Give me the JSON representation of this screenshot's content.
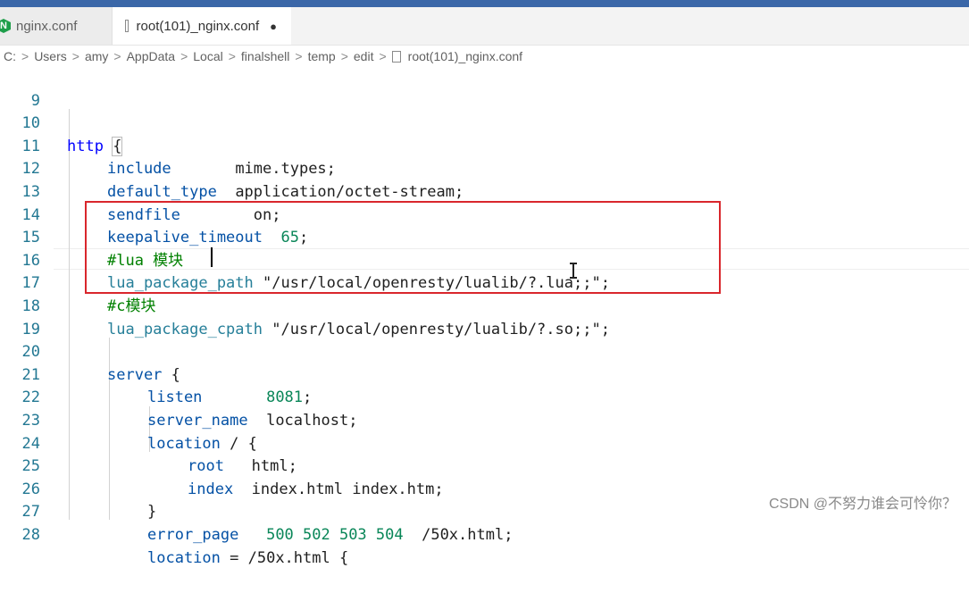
{
  "tabs": [
    {
      "label": "nginx.conf",
      "icon": "nginx-icon",
      "active": false
    },
    {
      "label": "root(101)_nginx.conf",
      "icon": "file-icon",
      "active": true,
      "dirty_marker": "●"
    }
  ],
  "breadcrumb": {
    "items": [
      "C:",
      "Users",
      "amy",
      "AppData",
      "Local",
      "finalshell",
      "temp",
      "edit"
    ],
    "file": "root(101)_nginx.conf",
    "separator": ">"
  },
  "lines": {
    "n9": "9",
    "n10": "10",
    "n11": "11",
    "n12": "12",
    "n13": "13",
    "n14": "14",
    "n15": "15",
    "n16": "16",
    "n17": "17",
    "n18": "18",
    "n19": "19",
    "n20": "20",
    "n21": "21",
    "n22": "22",
    "n23": "23",
    "n24": "24",
    "n25": "25",
    "n26": "26",
    "n27": "27",
    "n28": "28"
  },
  "code": {
    "l10_kw": "http",
    "l10_brace": "{",
    "l11_dir": "include",
    "l11_val": "mime.types;",
    "l12_dir": "default_type",
    "l12_val": "application/octet-stream;",
    "l13_dir": "sendfile",
    "l13_val": "on;",
    "l14_dir": "keepalive_timeout",
    "l14_num": "65",
    "l14_end": ";",
    "l15_comment": "#lua 模块",
    "l16_dir": "lua_package_path",
    "l16_val": "\"/usr/local/openresty/lualib/?.lua;;\";",
    "l17_comment": "#c模块",
    "l18_dir": "lua_package_cpath",
    "l18_val": "\"/usr/local/openresty/lualib/?.so;;\";",
    "l20_kw": "server",
    "l20_brace": "{",
    "l21_dir": "listen",
    "l21_num": "8081",
    "l21_end": ";",
    "l22_dir": "server_name",
    "l22_val": "localhost;",
    "l23_dir": "location",
    "l23_val": "/ {",
    "l24_dir": "root",
    "l24_val": "html;",
    "l25_dir": "index",
    "l25_val": "index.html index.htm;",
    "l26_brace": "}",
    "l27_dir": "error_page",
    "l27_num": "500 502 503 504",
    "l27_val": "/50x.html;",
    "l28_dir": "location",
    "l28_val": "= /50x.html {"
  },
  "colors": {
    "highlight_box": "#d9262c",
    "keyword": "#0000ff",
    "directive": "#267f99",
    "number": "#098658",
    "comment": "#008000",
    "line_number": "#237893"
  },
  "watermark": "CSDN @不努力谁会可怜你？"
}
